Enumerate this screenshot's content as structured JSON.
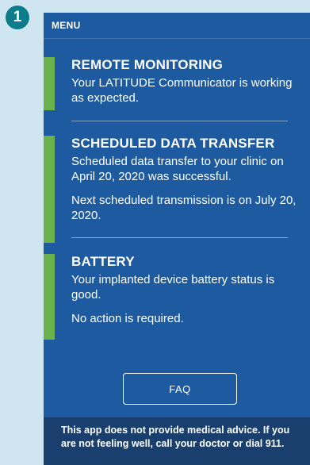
{
  "step": "1",
  "menu": {
    "label": "MENU"
  },
  "sections": [
    {
      "title": "REMOTE MONITORING",
      "lines": [
        "Your LATITUDE Communicator is working as expected."
      ]
    },
    {
      "title": "SCHEDULED DATA TRANSFER",
      "lines": [
        "Scheduled data transfer to your clinic on April 20, 2020 was successful.",
        "Next scheduled transmission is on July 20, 2020."
      ]
    },
    {
      "title": "BATTERY",
      "lines": [
        "Your implanted device battery status is good.",
        "No action is required."
      ]
    }
  ],
  "faq": {
    "label": "FAQ"
  },
  "footer": {
    "text": "This app does not provide medical advice. If you are not feeling well, call your doctor or dial 911."
  },
  "colors": {
    "background": "#1e5aa0",
    "accent_bar": "#6ab04c",
    "footer": "#183f6e",
    "badge": "#0a7c8c"
  }
}
